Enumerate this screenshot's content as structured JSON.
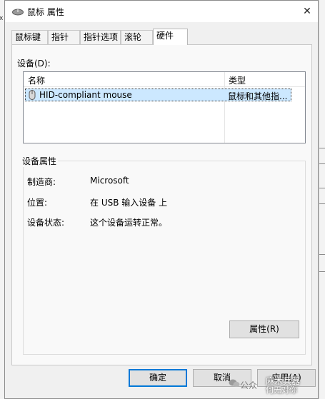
{
  "window": {
    "title": "鼠标 属性"
  },
  "tabs": [
    {
      "label": "鼠标键",
      "active": false
    },
    {
      "label": "指针",
      "active": false
    },
    {
      "label": "指针选项",
      "active": false
    },
    {
      "label": "滚轮",
      "active": false
    },
    {
      "label": "硬件",
      "active": true
    }
  ],
  "devices": {
    "label": "设备(D):",
    "columns": [
      "名称",
      "类型"
    ],
    "rows": [
      {
        "name": "HID-compliant mouse",
        "type": "鼠标和其他指...",
        "selected": true
      }
    ]
  },
  "properties": {
    "group_title": "设备属性",
    "items": [
      {
        "label": "制造商:",
        "value": "Microsoft"
      },
      {
        "label": "位置:",
        "value": "在 USB 输入设备 上"
      },
      {
        "label": "设备状态:",
        "value": "这个设备运转正常。"
      }
    ],
    "button_label": "属性(R)"
  },
  "buttons": {
    "ok": "确定",
    "cancel": "取消",
    "apply": "应用(A)"
  },
  "watermark": {
    "prefix": "公众",
    "line1": "麻木兵器",
    "line2": "何无对你"
  },
  "colors": {
    "selection": "#cce8ff",
    "focus_border": "#0078d7",
    "dialog_bg": "#f0f0f0"
  },
  "icons": {
    "app": "mouse-icon",
    "close": "close-icon",
    "device": "mouse-icon"
  }
}
